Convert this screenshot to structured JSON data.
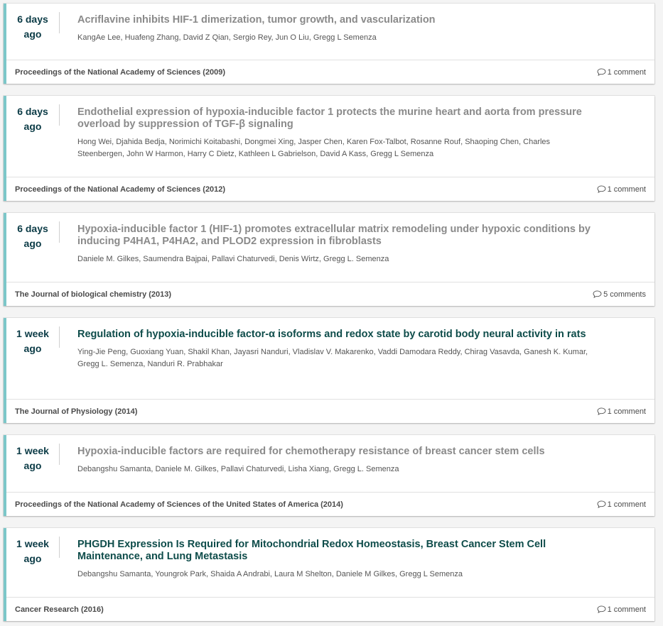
{
  "items": [
    {
      "age_num": "6 days",
      "age_unit": "ago",
      "title": "Acriflavine inhibits HIF-1 dimerization, tumor growth, and vascularization",
      "authors": "KangAe Lee, Huafeng Zhang, David Z Qian, Sergio Rey, Jun O Liu, Gregg L Semenza",
      "journal": "Proceedings of the National Academy of Sciences (2009)",
      "comments": "1 comment",
      "unread": false
    },
    {
      "age_num": "6 days",
      "age_unit": "ago",
      "title": "Endothelial expression of hypoxia-inducible factor 1 protects the murine heart and aorta from pressure overload by suppression of TGF-β signaling",
      "authors": "Hong Wei, Djahida Bedja, Norimichi Koitabashi, Dongmei Xing, Jasper Chen, Karen Fox-Talbot, Rosanne Rouf, Shaoping Chen, Charles Steenbergen, John W Harmon, Harry C Dietz, Kathleen L Gabrielson, David A Kass, Gregg L Semenza",
      "journal": "Proceedings of the National Academy of Sciences (2012)",
      "comments": "1 comment",
      "unread": false
    },
    {
      "age_num": "6 days",
      "age_unit": "ago",
      "title": "Hypoxia-inducible factor 1 (HIF-1) promotes extracellular matrix remodeling under hypoxic conditions by inducing P4HA1, P4HA2, and PLOD2 expression in fibroblasts",
      "authors": "Daniele M. Gilkes, Saumendra Bajpai, Pallavi Chaturvedi, Denis Wirtz, Gregg L. Semenza",
      "journal": "The Journal of biological chemistry (2013)",
      "comments": "5 comments",
      "unread": false
    },
    {
      "age_num": "1 week",
      "age_unit": "ago",
      "title": "Regulation of hypoxia-inducible factor-α isoforms and redox state by carotid body neural activity in rats",
      "authors": "Ying-Jie Peng, Guoxiang Yuan, Shakil Khan, Jayasri Nanduri, Vladislav V. Makarenko, Vaddi Damodara Reddy, Chirag Vasavda, Ganesh K. Kumar, Gregg L. Semenza, Nanduri R. Prabhakar",
      "journal": "The Journal of Physiology (2014)",
      "comments": "1 comment",
      "unread": true
    },
    {
      "age_num": "1 week",
      "age_unit": "ago",
      "title": "Hypoxia-inducible factors are required for chemotherapy resistance of breast cancer stem cells",
      "authors": "Debangshu Samanta, Daniele M. Gilkes, Pallavi Chaturvedi, Lisha Xiang, Gregg L. Semenza",
      "journal": "Proceedings of the National Academy of Sciences of the United States of America (2014)",
      "comments": "1 comment",
      "unread": false
    },
    {
      "age_num": "1 week",
      "age_unit": "ago",
      "title": "PHGDH Expression Is Required for Mitochondrial Redox Homeostasis, Breast Cancer Stem Cell Maintenance, and Lung Metastasis",
      "authors": "Debangshu Samanta, Youngrok Park, Shaida A Andrabi, Laura M Shelton, Daniele M Gilkes, Gregg L Semenza",
      "journal": "Cancer Research (2016)",
      "comments": "1 comment",
      "unread": true
    }
  ],
  "colors": {
    "accent_border": "#7cc7c9",
    "title_read": "#8a8a8a",
    "title_unread": "#0e4c4a",
    "age_text": "#0b3b46"
  },
  "icons": {
    "comment": "comment-bubble-icon"
  }
}
